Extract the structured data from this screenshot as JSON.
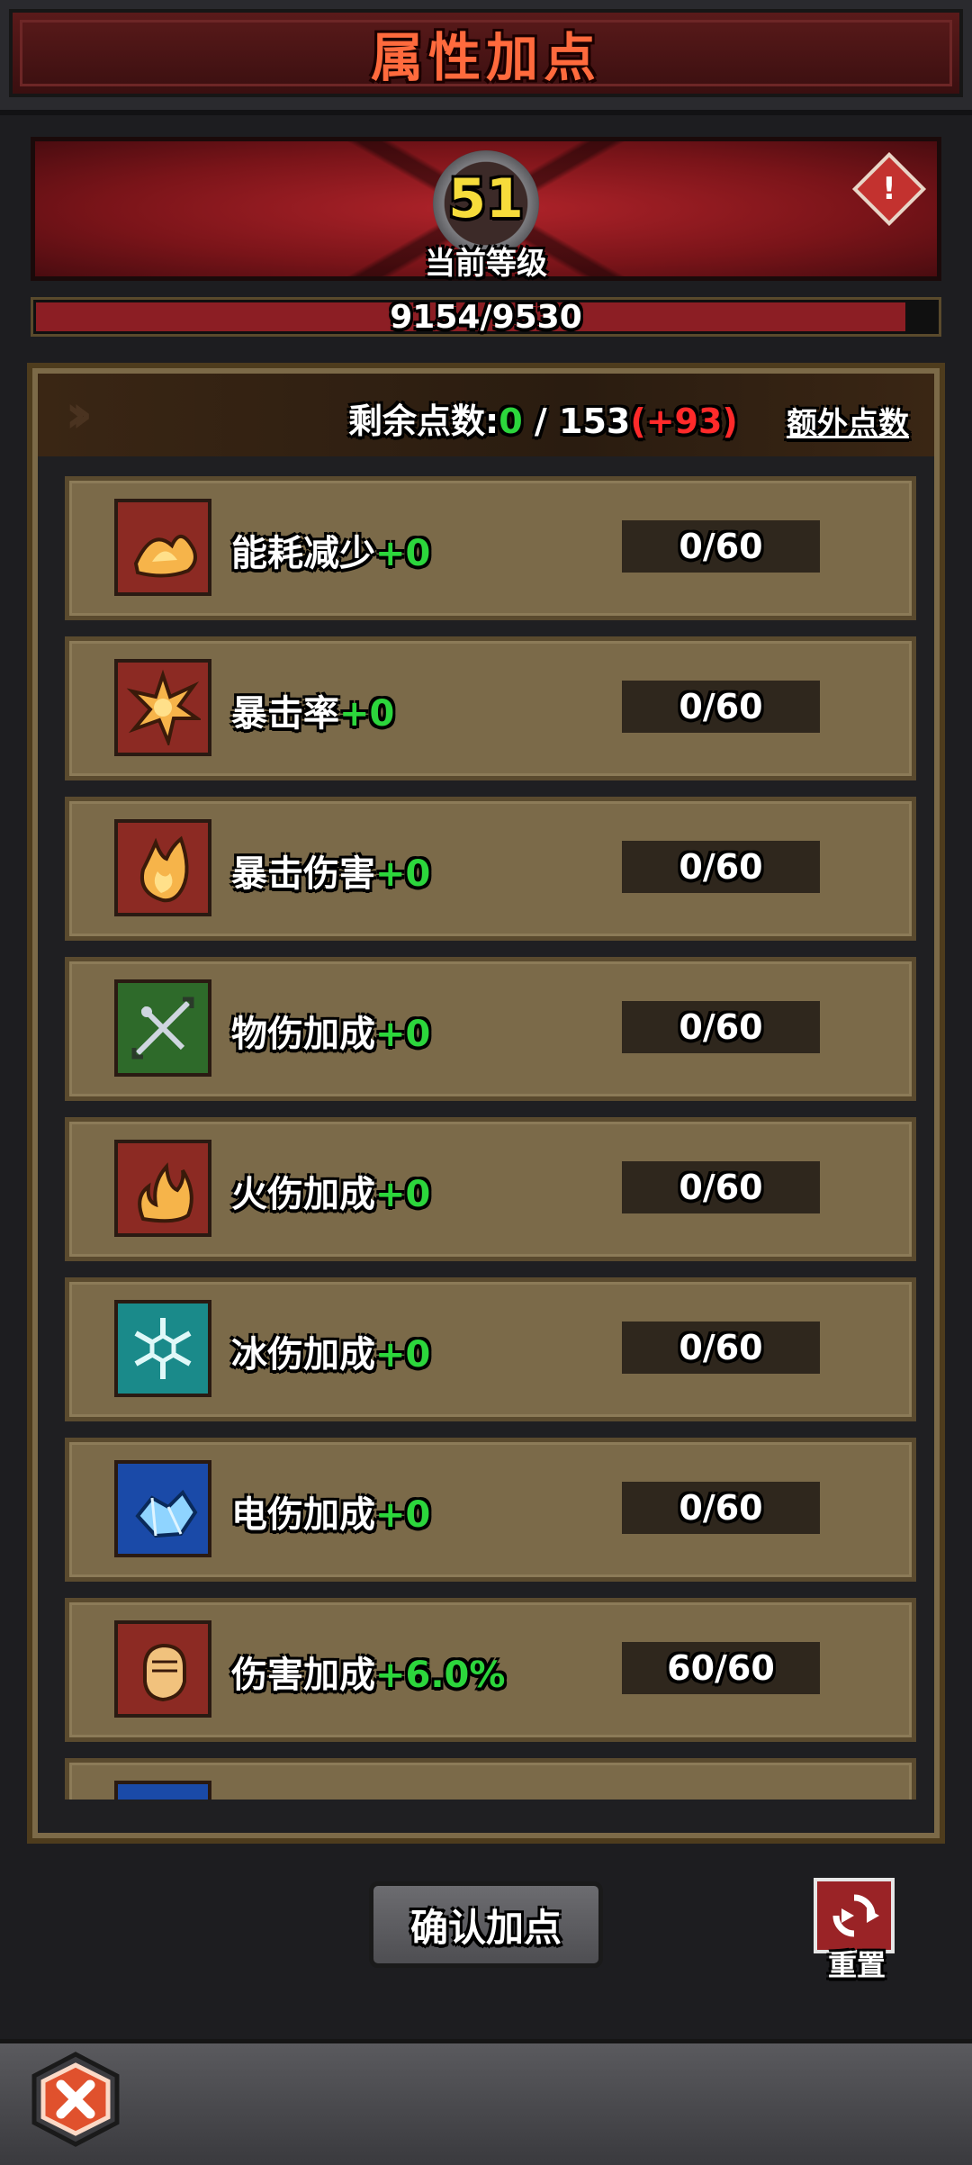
{
  "header": {
    "title": "属性加点"
  },
  "level": {
    "number": "51",
    "label": "当前等级"
  },
  "xp": {
    "text": "9154/9530",
    "progress": 0.96
  },
  "points": {
    "label": "剩余点数:",
    "remaining": "0",
    "separator": " / ",
    "total": "153",
    "bonus": "(+93)",
    "extra_label": "额外点数"
  },
  "attributes": [
    {
      "name": "能耗减少",
      "bonus": "+0",
      "value": "0/60",
      "icon": "flame-pile-icon",
      "color": "#8c2a23"
    },
    {
      "name": "暴击率",
      "bonus": "+0",
      "value": "0/60",
      "icon": "burst-icon",
      "color": "#8c2a23"
    },
    {
      "name": "暴击伤害",
      "bonus": "+0",
      "value": "0/60",
      "icon": "fire-icon",
      "color": "#8c2a23"
    },
    {
      "name": "物伤加成",
      "bonus": "+0",
      "value": "0/60",
      "icon": "crossed-arrows-icon",
      "color": "#2e6a2a"
    },
    {
      "name": "火伤加成",
      "bonus": "+0",
      "value": "0/60",
      "icon": "flames-icon",
      "color": "#8c2a23"
    },
    {
      "name": "冰伤加成",
      "bonus": "+0",
      "value": "0/60",
      "icon": "snowflake-icon",
      "color": "#1a8a8a"
    },
    {
      "name": "电伤加成",
      "bonus": "+0",
      "value": "0/60",
      "icon": "crystal-icon",
      "color": "#1a4aa8"
    },
    {
      "name": "伤害加成",
      "bonus": "+6.0%",
      "value": "60/60",
      "icon": "fist-icon",
      "color": "#8c2a23"
    }
  ],
  "buttons": {
    "confirm": "确认加点",
    "reset": "重置"
  }
}
